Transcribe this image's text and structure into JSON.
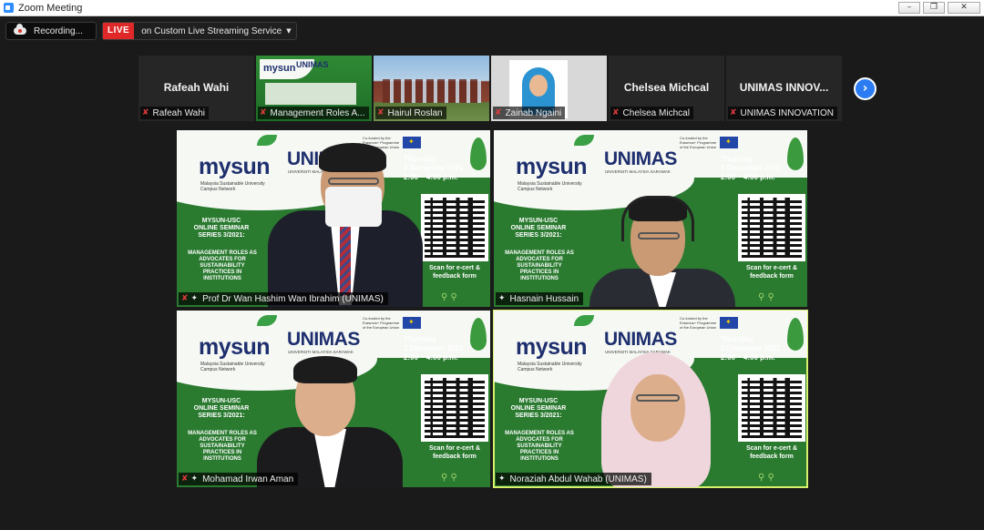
{
  "window": {
    "title": "Zoom Meeting",
    "controls": [
      "–",
      "❐",
      "✕"
    ]
  },
  "recording": {
    "label": "Recording..."
  },
  "live": {
    "badge": "LIVE",
    "service": "on Custom Live Streaming Service"
  },
  "strip": {
    "items": [
      {
        "big_name": "Rafeah Wahi",
        "name": "Rafeah Wahi",
        "muted": true,
        "kind": "name"
      },
      {
        "big_name": "",
        "name": "Management Roles A...",
        "muted": true,
        "kind": "slide"
      },
      {
        "big_name": "",
        "name": "Hairul Roslan",
        "muted": true,
        "kind": "photo"
      },
      {
        "big_name": "",
        "name": "Zainab Ngaini",
        "muted": true,
        "kind": "portrait"
      },
      {
        "big_name": "Chelsea Michcal",
        "name": "Chelsea Michcal",
        "muted": true,
        "kind": "name"
      },
      {
        "big_name": "UNIMAS INNOV...",
        "name": "UNIMAS INNOVATION",
        "muted": true,
        "kind": "name"
      }
    ]
  },
  "slide": {
    "brand": "mysun",
    "brand_sub": "Malaysia Sustainable University Campus Network",
    "uni": "UNIMAS",
    "uni_sub": "UNIVERSITI MALAYSIA SARAWAK",
    "eu_note": "Co-funded by the Erasmus+ Programme of the European Union",
    "day": "Thursday",
    "date": "2 December 2021",
    "time": "2:00 – 4:00 p.m.",
    "series": "MYSUN-USC ONLINE SEMINAR SERIES 3/2021:",
    "topic": "MANAGEMENT ROLES AS ADVOCATES FOR SUSTAINABILITY PRACTICES IN INSTITUTIONS",
    "scan": "Scan for e-cert & feedback form"
  },
  "tiles": [
    {
      "name": "Prof Dr Wan Hashim Wan Ibrahim (UNIMAS)",
      "muted": true,
      "active": false
    },
    {
      "name": "Hasnain Hussain",
      "muted": false,
      "active": false
    },
    {
      "name": "Mohamad Irwan Aman",
      "muted": true,
      "active": false
    },
    {
      "name": "Noraziah Abdul Wahab (UNIMAS)",
      "muted": false,
      "active": true
    }
  ],
  "icons": {
    "mute": "mic-muted-icon",
    "pin": "pin-icon",
    "next": "chevron-right-icon"
  },
  "colors": {
    "live": "#e02828",
    "accent": "#2b7bf2",
    "active_speaker": "#d7f26a"
  }
}
